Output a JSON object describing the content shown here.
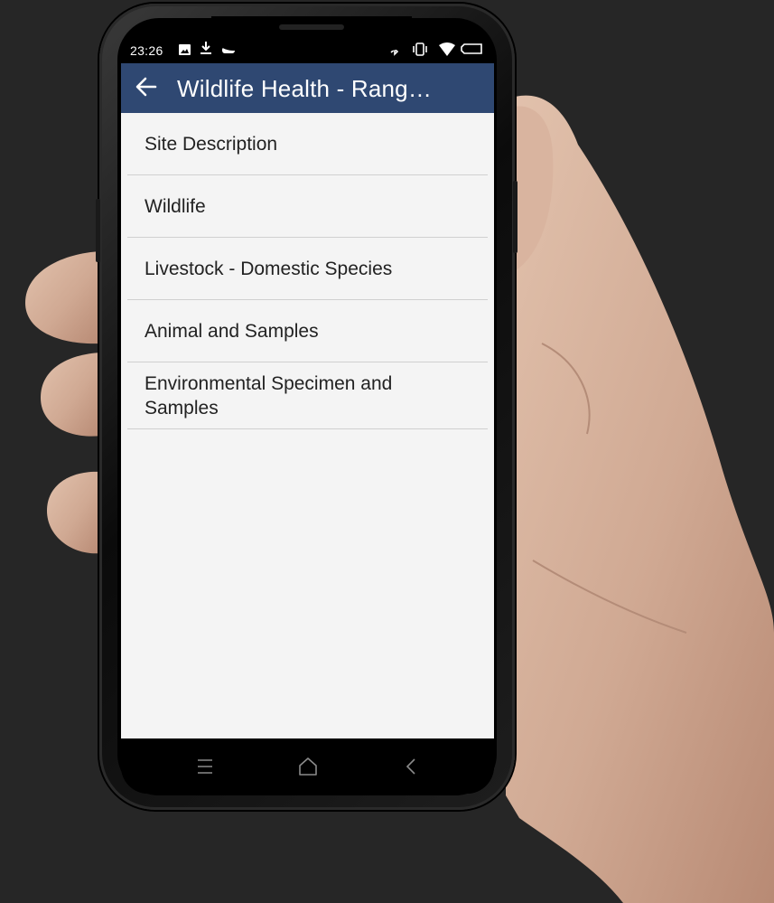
{
  "status_bar": {
    "time": "23:26",
    "left_icons": [
      "image-icon",
      "download-icon",
      "notification-icon"
    ],
    "right_icons": [
      "bluetooth-icon",
      "vibrate-icon",
      "wifi-icon",
      "battery-icon"
    ]
  },
  "app_bar": {
    "title": "Wildlife Health - Rang…",
    "back_icon": "arrow-left-icon",
    "color": "#2f4872"
  },
  "menu": {
    "items": [
      {
        "label": "Site Description"
      },
      {
        "label": "Wildlife"
      },
      {
        "label": "Livestock - Domestic Species"
      },
      {
        "label": "Animal and Samples"
      },
      {
        "label": "Environmental Specimen and Samples"
      }
    ]
  },
  "nav_bar": {
    "buttons": [
      "menu-icon",
      "home-icon",
      "back-chevron-icon"
    ]
  }
}
